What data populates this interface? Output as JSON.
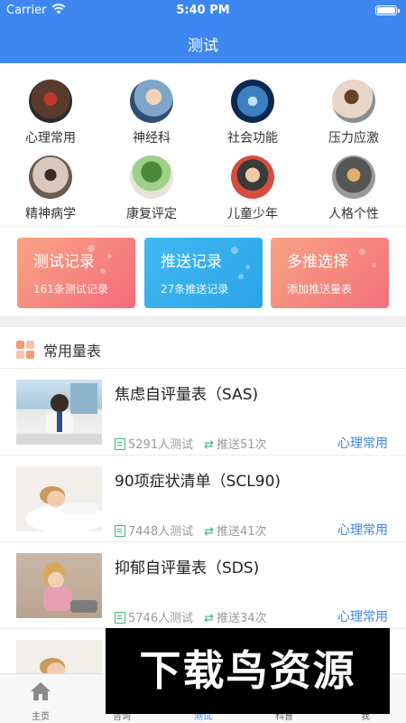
{
  "status": {
    "carrier": "Carrier",
    "time": "5:40 PM"
  },
  "header": {
    "title": "测试"
  },
  "categories": [
    {
      "label": "心理常用",
      "icon": "psych-common-icon"
    },
    {
      "label": "神经科",
      "icon": "neurology-icon"
    },
    {
      "label": "社会功能",
      "icon": "social-function-icon"
    },
    {
      "label": "压力应激",
      "icon": "stress-icon"
    },
    {
      "label": "精神病学",
      "icon": "psychiatry-icon"
    },
    {
      "label": "康复评定",
      "icon": "rehab-icon"
    },
    {
      "label": "儿童少年",
      "icon": "children-icon"
    },
    {
      "label": "人格个性",
      "icon": "personality-icon"
    }
  ],
  "cards": [
    {
      "title": "测试记录",
      "subtitle": "161条测试记录"
    },
    {
      "title": "推送记录",
      "subtitle": "27条推送记录"
    },
    {
      "title": "多推选择",
      "subtitle": "添加推送量表"
    }
  ],
  "section": {
    "title": "常用量表"
  },
  "scales": [
    {
      "title": "焦虑自评量表（SAS)",
      "tested": "5291人测试",
      "pushed": "推送51次",
      "category": "心理常用"
    },
    {
      "title": "90项症状清单（SCL90)",
      "tested": "7448人测试",
      "pushed": "推送41次",
      "category": "心理常用"
    },
    {
      "title": "抑郁自评量表（SDS)",
      "tested": "5746人测试",
      "pushed": "推送34次",
      "category": "心理常用"
    }
  ],
  "tabs": [
    {
      "label": "主页"
    },
    {
      "label": "咨询"
    },
    {
      "label": "测试"
    },
    {
      "label": "科普"
    },
    {
      "label": "我"
    }
  ],
  "watermark": "下载鸟资源",
  "colors": {
    "primary": "#3e87f0",
    "accent_green": "#34b47a",
    "tag_blue": "#3d87e8"
  }
}
